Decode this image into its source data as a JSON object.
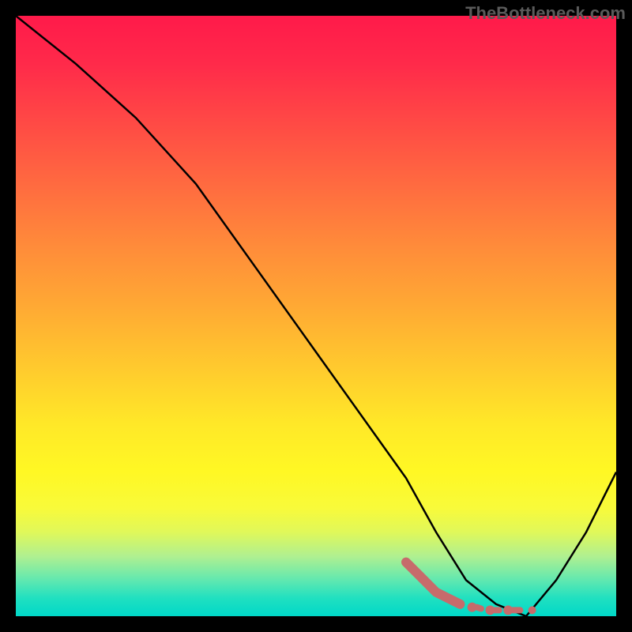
{
  "watermark": "TheBottleneck.com",
  "chart_data": {
    "type": "line",
    "title": "",
    "xlabel": "",
    "ylabel": "",
    "xlim": [
      0,
      100
    ],
    "ylim": [
      0,
      100
    ],
    "series": [
      {
        "name": "curve",
        "color": "#000000",
        "x": [
          0,
          10,
          20,
          30,
          40,
          50,
          60,
          65,
          70,
          75,
          80,
          85,
          90,
          95,
          100
        ],
        "y": [
          100,
          92,
          83,
          72,
          58,
          44,
          30,
          23,
          14,
          6,
          2,
          0,
          6,
          14,
          24
        ]
      },
      {
        "name": "highlight-dots",
        "color": "#c76b6b",
        "x": [
          65,
          67,
          69,
          70,
          72,
          74,
          76,
          79,
          82,
          86
        ],
        "y": [
          9,
          7,
          5,
          4,
          3,
          2,
          1.5,
          1,
          1,
          1
        ]
      }
    ],
    "background_gradient": {
      "orientation": "vertical",
      "stops": [
        {
          "pos": 0.0,
          "color": "#ff1a4a"
        },
        {
          "pos": 0.5,
          "color": "#ffb030"
        },
        {
          "pos": 0.8,
          "color": "#fff824"
        },
        {
          "pos": 1.0,
          "color": "#00d8c8"
        }
      ]
    }
  }
}
